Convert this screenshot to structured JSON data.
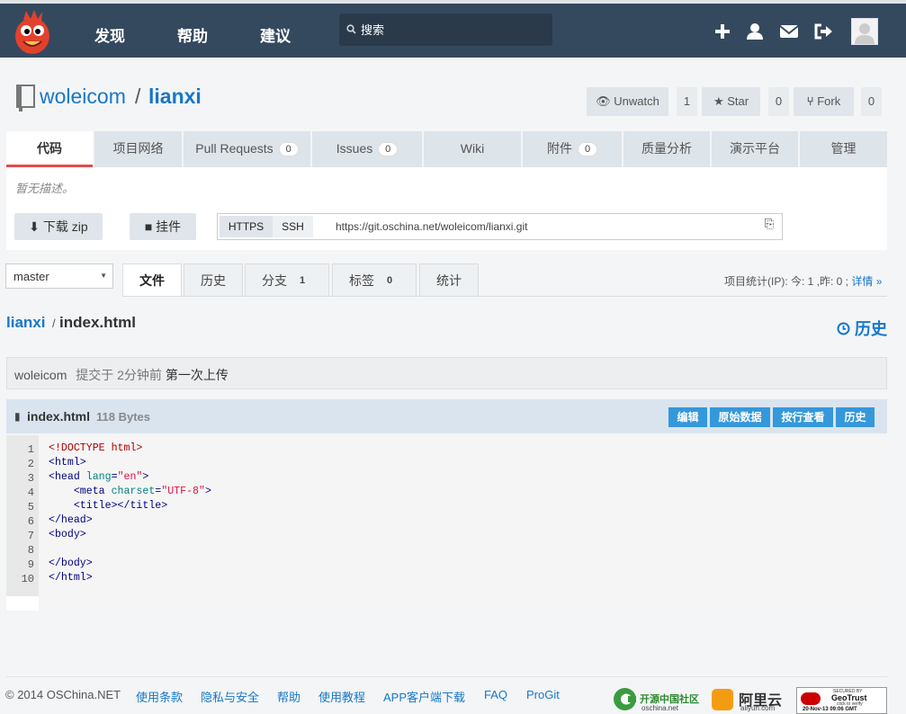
{
  "nav": {
    "items": [
      "发现",
      "帮助",
      "建议"
    ],
    "search_placeholder": "搜索"
  },
  "repo": {
    "owner": "woleicom",
    "separator": "/",
    "name": "lianxi",
    "actions": [
      {
        "label": "Unwatch",
        "count": "1"
      },
      {
        "label": "Star",
        "count": "0"
      },
      {
        "label": "Fork",
        "count": "0"
      }
    ]
  },
  "tabs": [
    {
      "label": "代码",
      "count": null
    },
    {
      "label": "项目网络",
      "count": null
    },
    {
      "label": "Pull Requests",
      "count": "0"
    },
    {
      "label": "Issues",
      "count": "0"
    },
    {
      "label": "Wiki",
      "count": null
    },
    {
      "label": "附件",
      "count": "0"
    },
    {
      "label": "质量分析",
      "count": null
    },
    {
      "label": "演示平台",
      "count": null
    },
    {
      "label": "管理",
      "count": null
    }
  ],
  "description": "暂无描述。",
  "toolbar": {
    "download_label": "下载 zip",
    "widget_label": "挂件",
    "https_label": "HTTPS",
    "ssh_label": "SSH",
    "clone_url": "https://git.oschina.net/woleicom/lianxi.git"
  },
  "branch": {
    "selected": "master"
  },
  "file_tabs": [
    {
      "label": "文件",
      "count": null
    },
    {
      "label": "历史",
      "count": null
    },
    {
      "label": "分支",
      "count": "1"
    },
    {
      "label": "标签",
      "count": "0"
    },
    {
      "label": "统计",
      "count": null
    }
  ],
  "stats": {
    "text": "项目统计(IP): 今: 1 ,昨: 0 ;",
    "link": "详情 »"
  },
  "breadcrumb": {
    "repo": "lianxi",
    "separator": "/",
    "file": "index.html"
  },
  "history_label": "历史",
  "commit": {
    "author": "woleicom",
    "text": "提交于 2分钟前",
    "message": "第一次上传"
  },
  "file": {
    "name": "index.html",
    "size": "118 Bytes",
    "buttons": [
      "编辑",
      "原始数据",
      "按行查看",
      "历史"
    ]
  },
  "code_lines": [
    "<!DOCTYPE html>",
    "<html>",
    "<head lang=\"en\">",
    "    <meta charset=\"UTF-8\">",
    "    <title></title>",
    "</head>",
    "<body>",
    "",
    "</body>",
    "</html>"
  ],
  "footer": {
    "copyright": "© 2014 OSChina.NET",
    "links": [
      "使用条款",
      "隐私与安全",
      "帮助",
      "使用教程",
      "APP客户端下载",
      "FAQ",
      "ProGit"
    ],
    "badges": {
      "oschina": "开源中国社区",
      "oschina_sub": "oschina.net",
      "aliyun": "阿里云",
      "aliyun_sub": "aliyun.com",
      "geotrust": "GeoTrust",
      "geotrust_top": "SECURED BY",
      "geotrust_sub": "click to verify",
      "geotrust_date": "20-Nov-13 09:06 GMT"
    }
  },
  "colors": {
    "topbar": "#34495e",
    "accent": "#1677c9",
    "active_tab_border": "#e14c4c",
    "file_button": "#3498db"
  }
}
